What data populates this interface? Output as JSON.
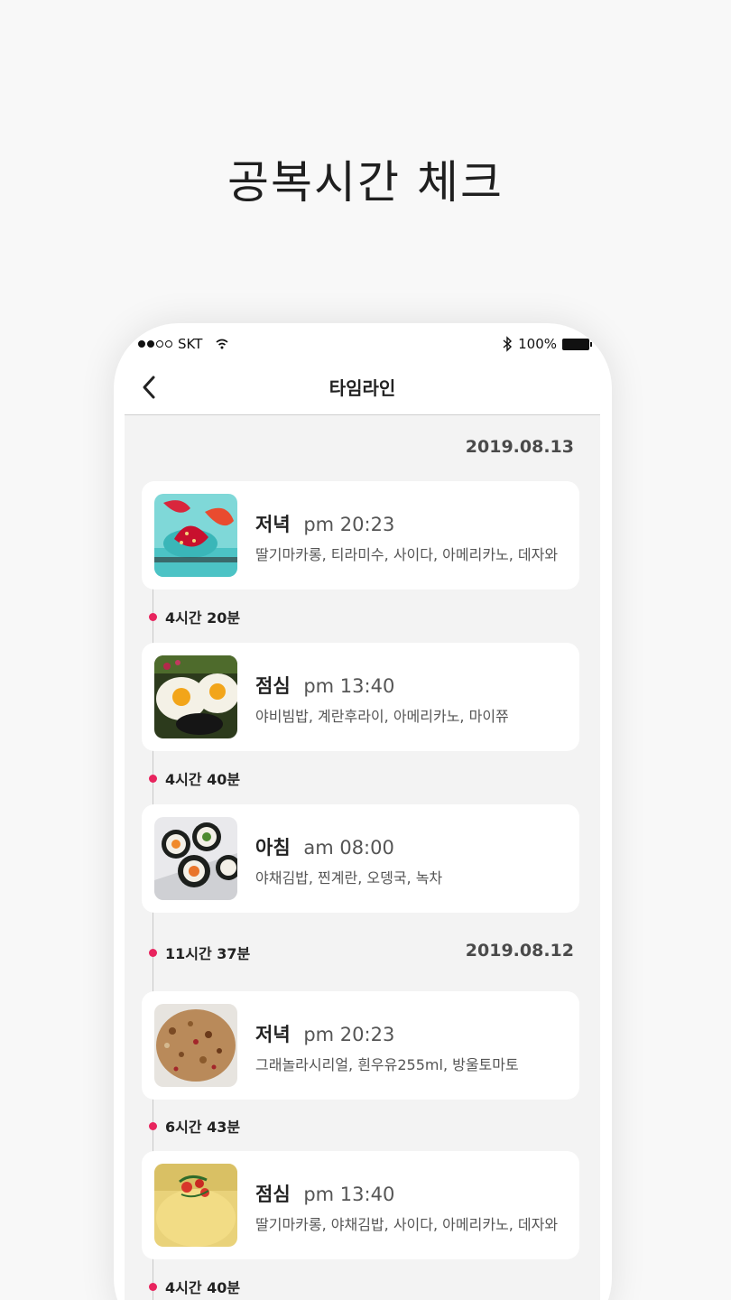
{
  "headline": "공복시간 체크",
  "status_bar": {
    "carrier": "SKT",
    "battery": "100%",
    "wifi_icon": "wifi-icon",
    "bluetooth_icon": "bluetooth-icon"
  },
  "navbar": {
    "title": "타임라인",
    "back_icon": "chevron-left-icon"
  },
  "colors": {
    "accent": "#e8245e",
    "background": "#f3f3f3",
    "card": "#ffffff"
  },
  "timeline": {
    "dates": [
      "2019.08.13",
      "2019.08.12"
    ],
    "entries": [
      {
        "meal": "저녁",
        "time": "pm 20:23",
        "foods": "딸기마카롱, 티라미수, 사이다, 아메리카노, 데자와"
      },
      {
        "meal": "점심",
        "time": "pm 13:40",
        "foods": "야비빔밥, 계란후라이, 아메리카노, 마이쮸"
      },
      {
        "meal": "아침",
        "time": "am 08:00",
        "foods": "야채김밥, 찐계란, 오뎅국, 녹차"
      },
      {
        "meal": "저녁",
        "time": "pm 20:23",
        "foods": "그래놀라시리얼, 흰우유255ml, 방울토마토"
      },
      {
        "meal": "점심",
        "time": "pm 13:40",
        "foods": "딸기마카롱, 야채김밥, 사이다, 아메리카노, 데자와"
      }
    ],
    "gaps": [
      "4시간 20분",
      "4시간 40분",
      "11시간 37분",
      "6시간 43분",
      "4시간 40분"
    ]
  }
}
